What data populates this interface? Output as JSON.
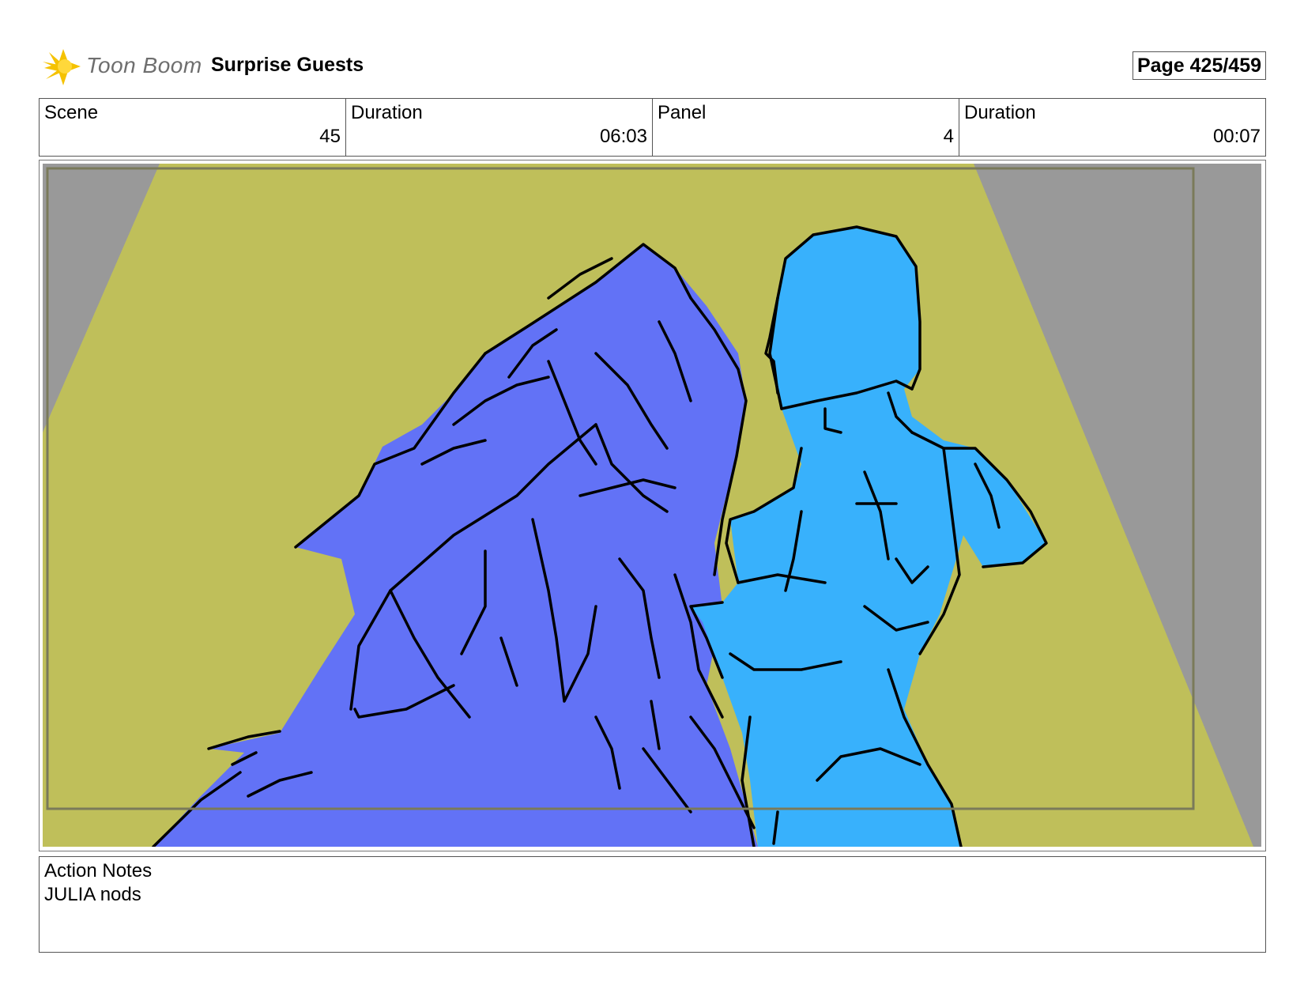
{
  "header": {
    "brand": "Toon Boom",
    "title": "Surprise Guests",
    "page": "Page 425/459"
  },
  "info": {
    "scene_label": "Scene",
    "scene_value": "45",
    "scene_duration_label": "Duration",
    "scene_duration_value": "06:03",
    "panel_label": "Panel",
    "panel_value": "4",
    "panel_duration_label": "Duration",
    "panel_duration_value": "00:07"
  },
  "panel_image": {
    "colors": {
      "background_gray": "#999999",
      "spotlight": "#bfbf5a",
      "left_character": "#6272f6",
      "right_character": "#38b1fc",
      "line": "#000000"
    }
  },
  "notes": {
    "label": "Action Notes",
    "text": "JULIA nods"
  }
}
